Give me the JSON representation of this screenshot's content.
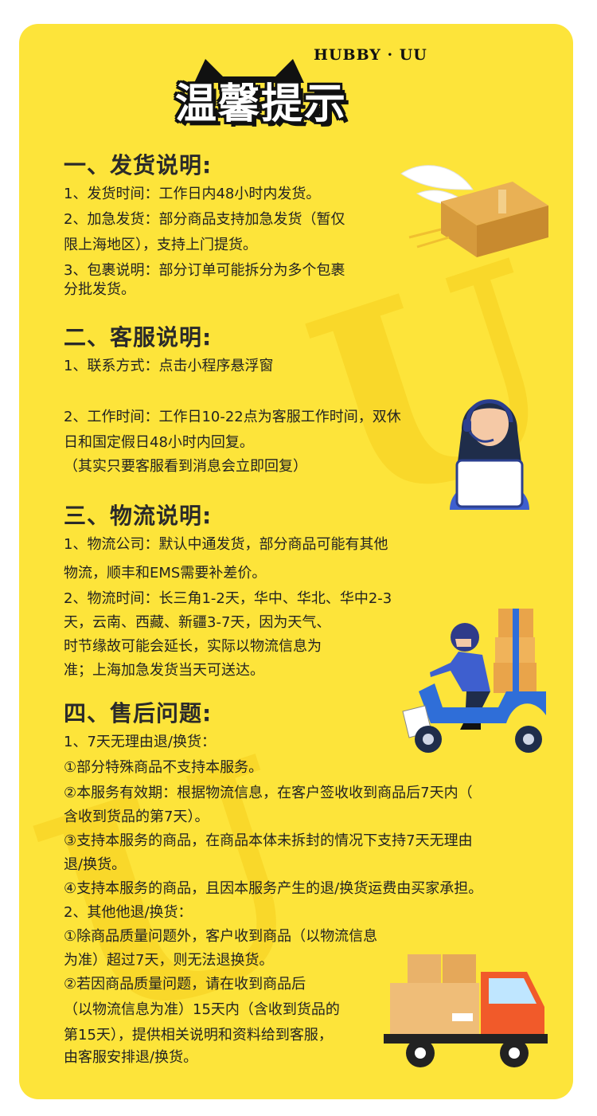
{
  "header": {
    "brand": "HUBBY · UU",
    "title": "温馨提示"
  },
  "sections": [
    {
      "title": "一、发货说明:",
      "lines": [
        "1、发货时间：工作日内48小时内发货。",
        "2、加急发货：部分商品支持加急发货（暂仅",
        "限上海地区），支持上门提货。",
        "3、包裹说明：部分订单可能拆分为多个包裹",
        "分批发货。"
      ]
    },
    {
      "title": "二、客服说明:",
      "lines": [
        "1、联系方式：点击小程序悬浮窗",
        "2、工作时间：工作日10-22点为客服工作时间，双休",
        "日和国定假日48小时内回复。",
        "（其实只要客服看到消息会立即回复）"
      ]
    },
    {
      "title": "三、物流说明:",
      "lines": [
        "1、物流公司：默认中通发货，部分商品可能有其他",
        "物流，顺丰和EMS需要补差价。",
        "2、物流时间：长三角1-2天，华中、华北、华中2-3",
        "天，云南、西藏、新疆3-7天，因为天气、",
        "时节缘故可能会延长，实际以物流信息为",
        "准；上海加急发货当天可送达。"
      ]
    },
    {
      "title": "四、售后问题:",
      "lines": [
        "1、7天无理由退/换货：",
        "①部分特殊商品不支持本服务。",
        "②本服务有效期：根据物流信息，在客户签收收到商品后7天内（",
        "含收到货品的第7天）。",
        "③支持本服务的商品，在商品本体未拆封的情况下支持7天无理由",
        "退/换货。",
        "④支持本服务的商品，且因本服务产生的退/换货运费由买家承担。",
        "2、其他他退/换货：",
        "①除商品质量问题外，客户收到商品（以物流信息",
        "为准）超过7天，则无法退换货。",
        "②若因商品质量问题，请在收到商品后",
        "（以物流信息为准）15天内（含收到货品的",
        "第15天），提供相关说明和资料给到客服，",
        "由客服安排退/换货。"
      ]
    }
  ],
  "watermark": "HUBBY",
  "colors": {
    "background": "#fde43a",
    "title_stroke": "#111111",
    "text": "#222222"
  }
}
